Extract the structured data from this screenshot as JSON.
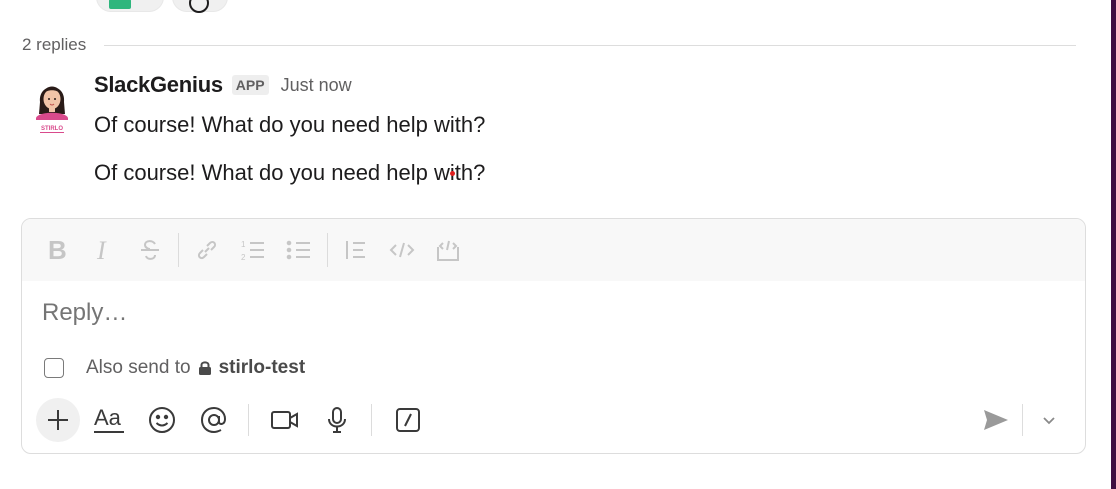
{
  "thread": {
    "replies_label": "2 replies"
  },
  "message": {
    "sender": "SlackGenius",
    "badge": "APP",
    "timestamp": "Just now",
    "avatar_caption": "STIRLO",
    "lines": [
      "Of course! What do you need help with?",
      "Of course! What do you need help with?"
    ]
  },
  "composer": {
    "placeholder": "Reply…",
    "also_send_label": "Also send to",
    "channel": "stirlo-test",
    "also_send_checked": false,
    "format_tools": [
      "bold-icon",
      "italic-icon",
      "strikethrough-icon",
      "link-icon",
      "ordered-list-icon",
      "bulleted-list-icon",
      "blockquote-icon",
      "code-icon",
      "code-block-icon"
    ],
    "bottom_tools": [
      "plus-icon",
      "formatting-icon",
      "emoji-icon",
      "mention-icon",
      "video-icon",
      "microphone-icon",
      "slash-command-icon",
      "send-icon",
      "chevron-down-icon"
    ]
  },
  "colors": {
    "sidebar_edge": "#3f0e40",
    "reaction_green": "#2eb67d",
    "cursor_dot": "#e01e1e"
  }
}
